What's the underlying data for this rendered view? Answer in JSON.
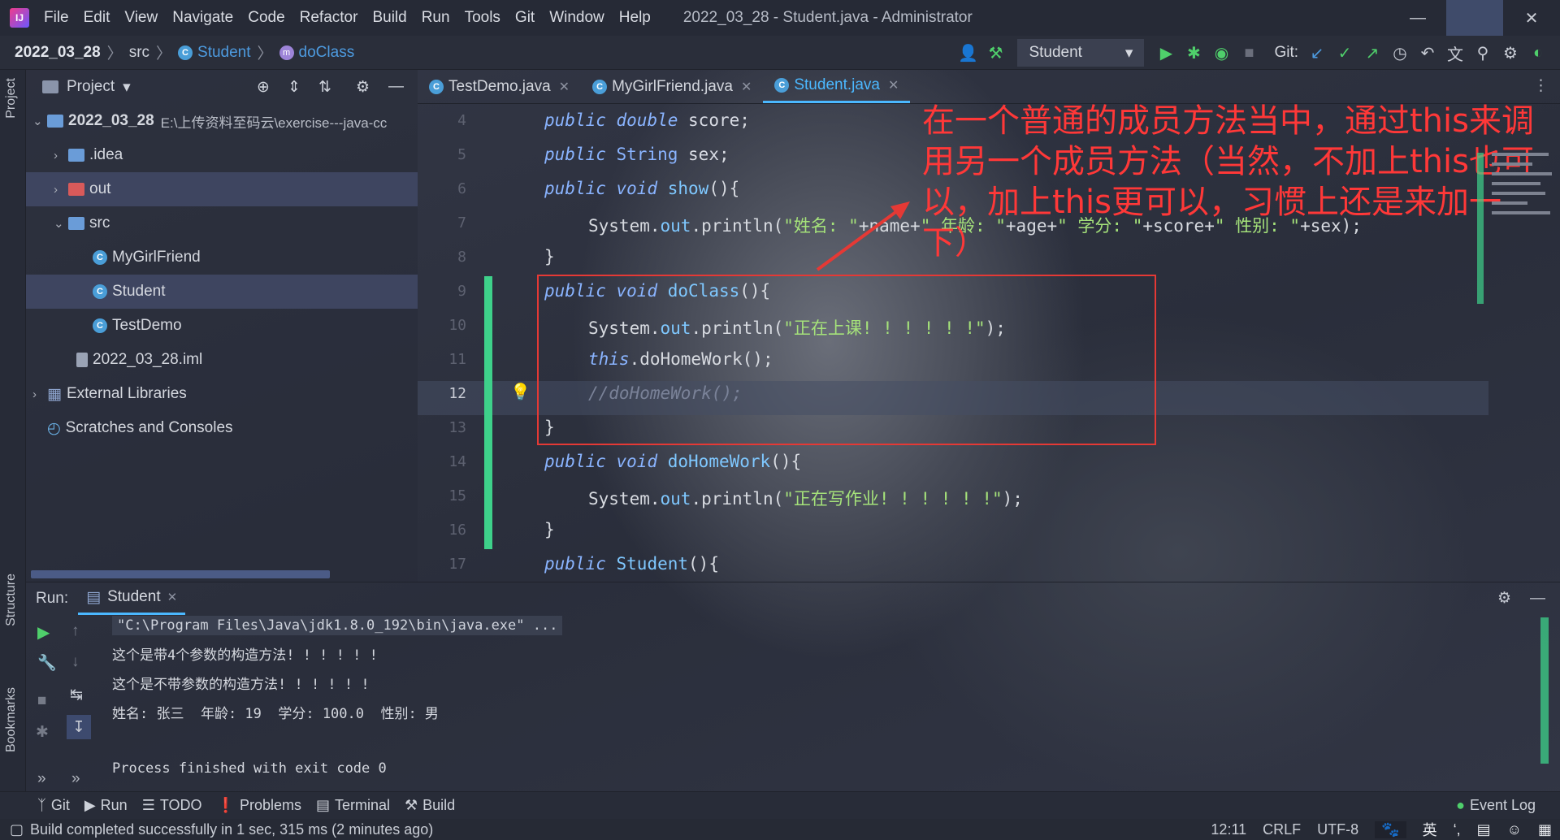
{
  "menubar": {
    "items": [
      "File",
      "Edit",
      "View",
      "Navigate",
      "Code",
      "Refactor",
      "Build",
      "Run",
      "Tools",
      "Git",
      "Window",
      "Help"
    ],
    "title": "2022_03_28 - Student.java - Administrator"
  },
  "breadcrumb": {
    "project": "2022_03_28",
    "src": "src",
    "class": "Student",
    "method": "doClass"
  },
  "toolbar": {
    "run_config": "Student",
    "git_label": "Git:"
  },
  "project_panel": {
    "title": "Project",
    "root": "2022_03_28",
    "root_path": "E:\\上传资料至码云\\exercise---java-cc",
    "items": [
      ".idea",
      "out",
      "src",
      "MyGirlFriend",
      "Student",
      "TestDemo",
      "2022_03_28.iml",
      "External Libraries",
      "Scratches and Consoles"
    ]
  },
  "left_strip": {
    "project": "Project",
    "structure": "Structure",
    "bookmarks": "Bookmarks"
  },
  "editor_tabs": [
    "TestDemo.java",
    "MyGirlFriend.java",
    "Student.java"
  ],
  "line_numbers": [
    "4",
    "5",
    "6",
    "7",
    "8",
    "9",
    "10",
    "11",
    "12",
    "13",
    "14",
    "15",
    "16",
    "17"
  ],
  "code": {
    "l4a": "public",
    "l4b": "double",
    "l4c": "score",
    "l5a": "public",
    "l5b": "String",
    "l5c": "sex",
    "l6a": "public",
    "l6b": "void",
    "l6c": "show",
    "l7a": "System.",
    "l7b": "out",
    "l7c": ".println(",
    "l7d": "\"姓名: \"",
    "l7e": "+name+",
    "l7f": "\" 年龄: \"",
    "l7g": "+age+",
    "l7h": "\" 学分: \"",
    "l7i": "+score+",
    "l7j": "\" 性别: \"",
    "l7k": "+sex);",
    "l8": "}",
    "l9a": "public",
    "l9b": "void",
    "l9c": "doClass",
    "l10a": "System.",
    "l10b": "out",
    "l10c": ".println(",
    "l10d": "\"正在上课! ! ! ! ! !\"",
    "l10e": ");",
    "l11a": "this",
    "l11b": ".doHomeWork();",
    "l12": "//doHomeWork();",
    "l13": "}",
    "l14a": "public",
    "l14b": "void",
    "l14c": "doHomeWork",
    "l15a": "System.",
    "l15b": "out",
    "l15c": ".println(",
    "l15d": "\"正在写作业! ! ! ! ! !\"",
    "l15e": ");",
    "l16": "}",
    "l17a": "public",
    "l17b": "Student"
  },
  "annotation": "在一个普通的成员方法当中，通过this来调用另一个成员方法（当然，不加上this也可以，加上this更可以，习惯上还是来加一下）",
  "run": {
    "label": "Run:",
    "tab": "Student",
    "lines": [
      "\"C:\\Program Files\\Java\\jdk1.8.0_192\\bin\\java.exe\" ...",
      "这个是带4个参数的构造方法! ! ! ! ! !",
      "这个是不带参数的构造方法! ! ! ! ! !",
      "姓名: 张三  年龄: 19  学分: 100.0  性别: 男",
      "Process finished with exit code 0"
    ]
  },
  "bottom_tools": [
    "Git",
    "Run",
    "TODO",
    "Problems",
    "Terminal",
    "Build",
    "Event Log"
  ],
  "status": {
    "message": "Build completed successfully in 1 sec, 315 ms (2 minutes ago)",
    "position": "12:11",
    "line_sep": "CRLF",
    "encoding": "UTF-8",
    "ime": "英"
  },
  "colors": {
    "accent": "#4bb8ff",
    "annotation": "#ff3838",
    "run_green": "#4fcf6b"
  }
}
